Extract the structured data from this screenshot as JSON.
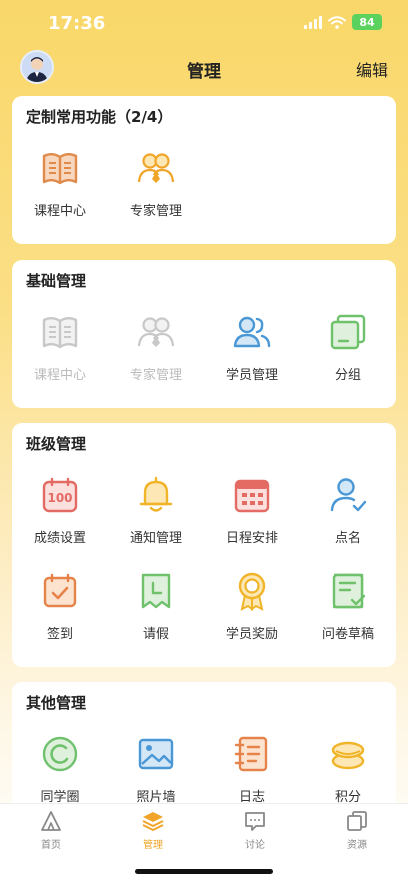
{
  "status_bar": {
    "time": "17:36",
    "battery": "84"
  },
  "header": {
    "title": "管理",
    "edit_label": "编辑"
  },
  "sections": {
    "custom": {
      "title": "定制常用功能（2/4）",
      "items": [
        {
          "label": "课程中心",
          "icon": "book-icon"
        },
        {
          "label": "专家管理",
          "icon": "experts-icon"
        }
      ]
    },
    "basic": {
      "title": "基础管理",
      "items": [
        {
          "label": "课程中心",
          "icon": "book-icon",
          "disabled": true
        },
        {
          "label": "专家管理",
          "icon": "experts-icon",
          "disabled": true
        },
        {
          "label": "学员管理",
          "icon": "students-icon"
        },
        {
          "label": "分组",
          "icon": "group-icon"
        }
      ]
    },
    "class": {
      "title": "班级管理",
      "items": [
        {
          "label": "成绩设置",
          "icon": "score-icon"
        },
        {
          "label": "通知管理",
          "icon": "bell-icon"
        },
        {
          "label": "日程安排",
          "icon": "calendar-icon"
        },
        {
          "label": "点名",
          "icon": "roll-call-icon"
        },
        {
          "label": "签到",
          "icon": "check-in-icon"
        },
        {
          "label": "请假",
          "icon": "leave-icon"
        },
        {
          "label": "学员奖励",
          "icon": "award-icon"
        },
        {
          "label": "问卷草稿",
          "icon": "survey-icon"
        }
      ]
    },
    "other": {
      "title": "其他管理",
      "items": [
        {
          "label": "同学圈",
          "icon": "circle-icon"
        },
        {
          "label": "照片墙",
          "icon": "photo-icon"
        },
        {
          "label": "日志",
          "icon": "log-icon"
        },
        {
          "label": "积分",
          "icon": "points-icon"
        }
      ]
    }
  },
  "tabbar": {
    "items": [
      {
        "label": "首页",
        "icon": "home-icon"
      },
      {
        "label": "管理",
        "icon": "manage-icon",
        "active": true
      },
      {
        "label": "讨论",
        "icon": "discussion-icon"
      },
      {
        "label": "资源",
        "icon": "resource-icon"
      }
    ]
  },
  "colors": {
    "accent": "#f0a428",
    "background_top": "#f9d769"
  }
}
